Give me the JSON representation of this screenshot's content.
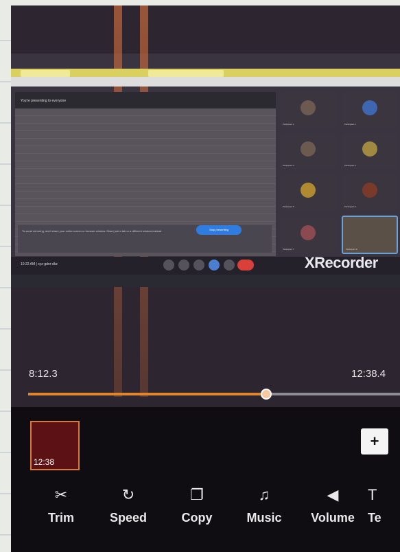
{
  "recorded_screen": {
    "presenting_banner": "You're presenting to everyone",
    "share_warning": "To avoid mirroring, don't share your entire screen or browser window. Share just a tab or a different window instead.",
    "stop_presenting_label": "Stop presenting",
    "meeting_time": "10:22 AM",
    "meeting_code": "xyz-gdnr-dkz",
    "participants": [
      "Participant 1",
      "Participant 2",
      "Participant 3",
      "Participant 4",
      "Participant 5",
      "Participant 6",
      "Participant 7",
      "Participant 8"
    ]
  },
  "watermark": "XRecorder",
  "editor": {
    "current_time": "8:12.3",
    "total_time": "12:38.4",
    "progress": 0.64,
    "clip_duration": "12:38",
    "add_label": "+",
    "accent_color": "#e0862e"
  },
  "toolbar": [
    {
      "label": "Trim",
      "icon": "scissors-icon",
      "glyph": "✂"
    },
    {
      "label": "Speed",
      "icon": "speed-icon",
      "glyph": "↻"
    },
    {
      "label": "Copy",
      "icon": "copy-icon",
      "glyph": "❐"
    },
    {
      "label": "Music",
      "icon": "music-icon",
      "glyph": "♫"
    },
    {
      "label": "Volume",
      "icon": "volume-icon",
      "glyph": "◀"
    },
    {
      "label": "Te",
      "icon": "text-icon",
      "glyph": "T"
    }
  ]
}
